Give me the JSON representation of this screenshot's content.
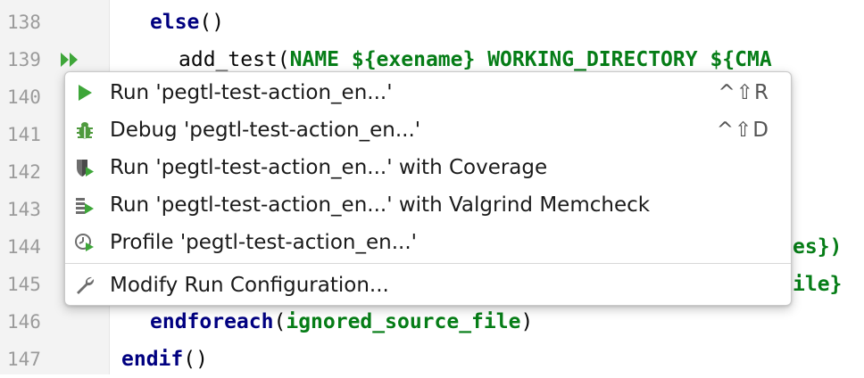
{
  "editor": {
    "line_numbers": [
      "138",
      "139",
      "140",
      "141",
      "142",
      "143",
      "144",
      "145",
      "146",
      "147"
    ],
    "lines": {
      "l138_kw": "else",
      "l138_rest": "()",
      "l139_pre": "add_test(",
      "l139_name": "NAME",
      "l139_var1": " ${exename} ",
      "l139_wd": "WORKING_DIRECTORY",
      "l139_var2": " ${CMA",
      "l144_frag": "es})",
      "l145_frag": "ile}",
      "l146_kw": "endforeach",
      "l146_open": "(",
      "l146_arg": "ignored_source_file",
      "l146_close": ")",
      "l147_kw": "endif",
      "l147_rest": "()"
    },
    "colors": {
      "keyword": "#000080",
      "argument": "#067d17",
      "gutter_text": "#9b9b9b",
      "run_icon": "#3ea639"
    }
  },
  "context_menu": {
    "items": [
      {
        "label": "Run 'pegtl-test-action_en...'",
        "shortcut": "^⇧R",
        "icon": "run-icon"
      },
      {
        "label": "Debug 'pegtl-test-action_en...'",
        "shortcut": "^⇧D",
        "icon": "debug-bug-icon"
      },
      {
        "label": "Run 'pegtl-test-action_en...' with Coverage",
        "shortcut": "",
        "icon": "coverage-shield-icon"
      },
      {
        "label": "Run 'pegtl-test-action_en...' with Valgrind Memcheck",
        "shortcut": "",
        "icon": "valgrind-icon"
      },
      {
        "label": "Profile 'pegtl-test-action_en...'",
        "shortcut": "",
        "icon": "profile-clock-icon"
      },
      {
        "label": "Modify Run Configuration...",
        "shortcut": "",
        "icon": "wrench-icon"
      }
    ]
  }
}
